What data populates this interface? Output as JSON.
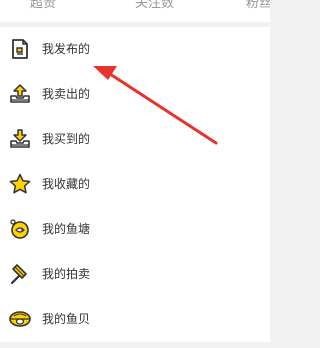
{
  "stats": {
    "items": [
      {
        "label": "超赞"
      },
      {
        "label": "关注数"
      },
      {
        "label": "粉丝"
      }
    ]
  },
  "menu": {
    "items": [
      {
        "label": "我发布的",
        "icon": "published-document-icon"
      },
      {
        "label": "我卖出的",
        "icon": "sold-upload-tray-icon"
      },
      {
        "label": "我买到的",
        "icon": "bought-download-tray-icon"
      },
      {
        "label": "我收藏的",
        "icon": "star-icon"
      },
      {
        "label": "我的鱼塘",
        "icon": "fish-pond-icon"
      },
      {
        "label": "我的拍卖",
        "icon": "auction-hammer-icon"
      },
      {
        "label": "我的鱼贝",
        "icon": "fish-shell-icon"
      }
    ]
  },
  "colors": {
    "accent_yellow": "#ffd200",
    "icon_dark": "#333333",
    "annotation_red": "#e8342d",
    "label_text": "#333333",
    "muted_text": "#999999"
  }
}
